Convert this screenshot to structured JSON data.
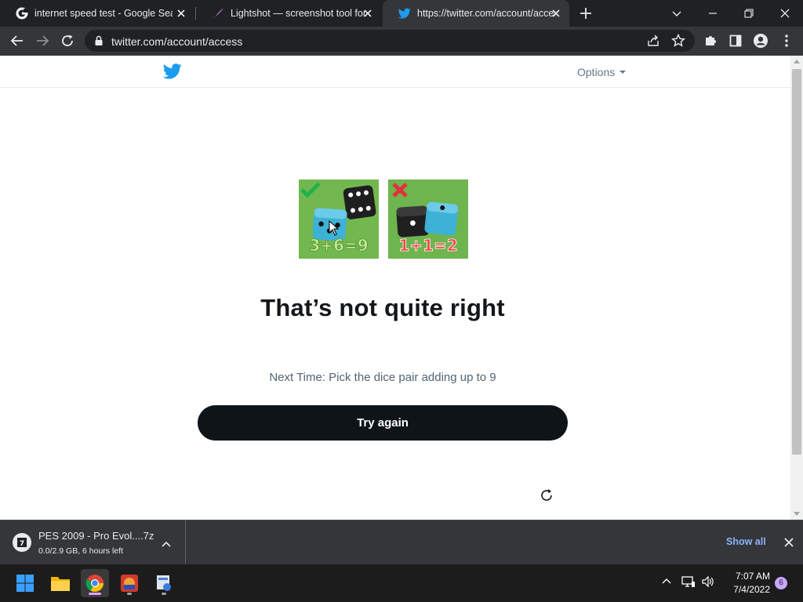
{
  "browser": {
    "tabs": [
      {
        "title": "internet speed test - Google Search",
        "icon": "google-icon"
      },
      {
        "title": "Lightshot — screenshot tool for Mac & Win",
        "icon": "lightshot-feather-icon"
      },
      {
        "title": "https://twitter.com/account/access",
        "icon": "twitter-bird-icon",
        "active": true
      }
    ],
    "url": "twitter.com/account/access"
  },
  "page": {
    "options_label": "Options",
    "headline": "That’s not quite right",
    "hint": "Next Time: Pick the dice pair adding up to 9",
    "try_again_label": "Try again",
    "dice_images": [
      {
        "equation": "3+6=9",
        "mark": "check",
        "status_color": "#21b24b"
      },
      {
        "equation": "1+1=2",
        "mark": "cross",
        "status_color": "#e0323b"
      }
    ]
  },
  "download_bar": {
    "file_name": "PES 2009 - Pro Evol....7z",
    "status": "0.0/2.9 GB, 6 hours left",
    "show_all_label": "Show all"
  },
  "taskbar": {
    "time": "7:07 AM",
    "date": "7/4/2022",
    "notification_count": "6"
  },
  "colors": {
    "twitter_blue": "#1d9bf0",
    "button_dark": "#0f1419",
    "chrome_dark": "#202124",
    "chrome_toolbar": "#35363a"
  }
}
